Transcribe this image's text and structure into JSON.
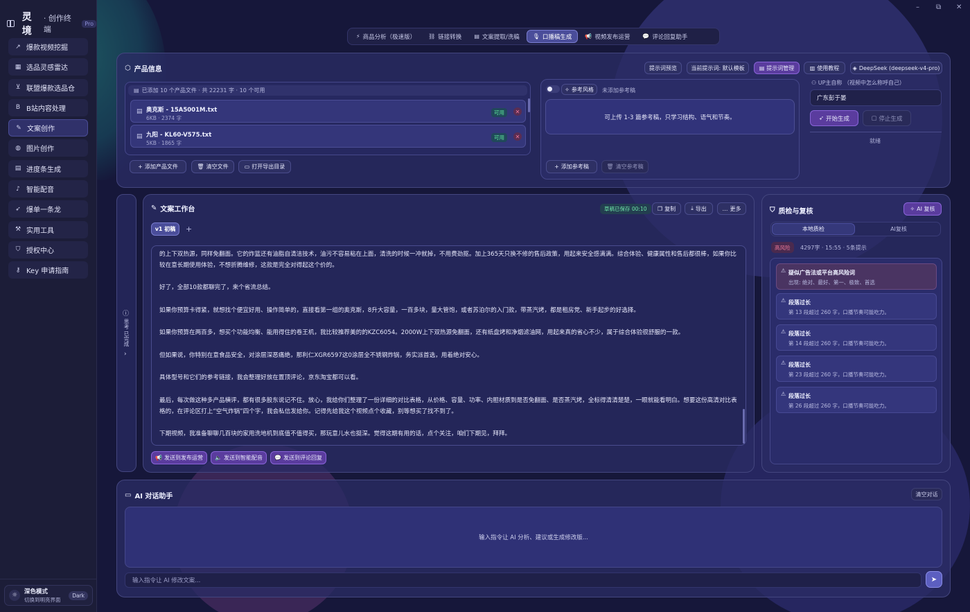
{
  "app": {
    "name": "灵境",
    "subtitle": "· 创作终端",
    "badge": "Pro"
  },
  "window": {
    "minimize": "–",
    "maximize": "⧉",
    "close": "✕"
  },
  "sidebar": {
    "items": [
      {
        "label": "爆款视频挖掘",
        "icon": "trend-icon"
      },
      {
        "label": "选品灵感雷达",
        "icon": "calendar-icon"
      },
      {
        "label": "联盟爆款选品仓",
        "icon": "cart-icon"
      },
      {
        "label": "B站内容处理",
        "icon": "bilibili-icon"
      },
      {
        "label": "文案创作",
        "icon": "pen-icon",
        "active": true
      },
      {
        "label": "图片创作",
        "icon": "palette-icon"
      },
      {
        "label": "进度条生成",
        "icon": "film-icon"
      },
      {
        "label": "智能配音",
        "icon": "mic-icon"
      },
      {
        "label": "爆单一条龙",
        "icon": "rocket-icon"
      },
      {
        "label": "实用工具",
        "icon": "wrench-icon"
      },
      {
        "label": "授权中心",
        "icon": "shield-icon"
      },
      {
        "label": "Key 申请指南",
        "icon": "key-icon"
      }
    ],
    "theme": {
      "title": "深色模式",
      "desc": "切换到明亮界面",
      "badge": "Dark"
    }
  },
  "top_tabs": [
    {
      "label": "商品分析（极速版）",
      "icon": "⚡"
    },
    {
      "label": "链接转换",
      "icon": "⛓"
    },
    {
      "label": "文案提取/洗稿",
      "icon": "▤"
    },
    {
      "label": "口播稿生成",
      "icon": "🎙",
      "active": true
    },
    {
      "label": "视频发布运营",
      "icon": "📢"
    },
    {
      "label": "评论回复助手",
      "icon": "💬"
    }
  ],
  "product": {
    "title": "产品信息",
    "buttons": {
      "preview": "提示词预览",
      "current": "当前提示词: 默认模板",
      "manage": "提示词管理",
      "tutorial": "使用教程",
      "model": "DeepSeek (deepseek-v4-pro)"
    },
    "files_summary": "已添加 10 个产品文件 · 共 22231 字 · 10 个可用",
    "files": [
      {
        "name": "奥克斯 - 15A5001M.txt",
        "meta": "6KB · 2374 字",
        "status": "可用"
      },
      {
        "name": "九阳 - KL60-V575.txt",
        "meta": "5KB · 1865 字",
        "status": "可用"
      }
    ],
    "actions": {
      "add": "添加产品文件",
      "clear": "清空文件",
      "open": "打开导出目录"
    },
    "reference": {
      "style_label": "参考风格",
      "none": "未添加参考稿",
      "hint": "可上传 1-3 篇参考稿，只学习结构、语气和节奏。",
      "add": "添加参考稿",
      "clear": "清空参考稿"
    },
    "up": {
      "label": "UP主自称 （视频中怎么称呼自己）",
      "value": "广东彭于晏"
    },
    "start": "开始生成",
    "stop": "停止生成",
    "status": "就绪"
  },
  "strip": {
    "label": "思考 已完成"
  },
  "workbench": {
    "title": "文案工作台",
    "saved": "草稿已保存 00:10",
    "copy": "复制",
    "export": "导出",
    "more": "更多",
    "version_tab": "v1 初稿",
    "add_tab": "+",
    "paragraphs": [
      "的上下双热源，同样免翻面。它的炸篮还有油脂自清洁技术，油污不容易粘在上面，清洗的时候一冲就掉，不用费劲抠。加上365天只换不修的售后政策，用起来安全感满满。综合体验、健康属性和售后都很棒，如果你比较在意长期使用体验，不想折腾维修，这款是完全对得起这个价的。",
      "好了，全部10款都聊完了，来个省流总结。",
      "如果你预算卡得紧，就想找个便宜好用、操作简单的，直接看第一组的奥克斯，8升大容量，一百多块，量大管饱，或者苏泊尔的入门款，带蒸汽烤，都是租房党、新手起步的好选择。",
      "如果你预算在两百多，想买个功能均衡、能用得住的卷王机，我比较推荐美的的KZC6054。2000W上下双热源免翻面，还有纸盘烤和净烟滤油网，用起来真的省心不少，属于综合体验很舒服的一款。",
      "但如果说，你特别在意食品安全，对涂层深恶痛绝，那利仁XGR6597这0涂层全不锈钢炸锅，务实派首选，用着绝对安心。",
      "具体型号和它们的参考链接，我会整理好放在置顶评论，京东淘宝都可以看。",
      "最后，每次做这种多产品横评，都有很多股东说记不住。放心，我给你们整理了一份详细的对比表格，从价格、容量、功率、内胆材质到是否免翻面、是否蒸汽烤，全标得清清楚楚，一眼就能看明白。想要这份高清对比表格的，在评论区打上“空气炸锅”四个字，我会私信发给你。记得先给我这个视频点个收藏，别等想买了找不到了。",
      "下期视频，我准备聊聊几百块的家用洗地机到底值不值得买，那玩意儿水也挺深。觉得这期有用的话，点个关注，咱们下期见，拜拜。"
    ],
    "send": {
      "publish": "发送到发布运营",
      "voice": "发送到智能配音",
      "comment": "发送到评论回复"
    }
  },
  "quality": {
    "title": "质检与复核",
    "ai_review": "AI 复核",
    "tabs": [
      "本地质检",
      "AI复核"
    ],
    "risk": "高风险",
    "meta": "4297字 · 15:55 · 5条提示",
    "issues": [
      {
        "title": "疑似广告法或平台高风险词",
        "desc": "出现: 绝对、最好、第一、极致、首选"
      },
      {
        "title": "段落过长",
        "desc": "第 13 段超过 260 字，口播节奏可能吃力。"
      },
      {
        "title": "段落过长",
        "desc": "第 14 段超过 260 字，口播节奏可能吃力。"
      },
      {
        "title": "段落过长",
        "desc": "第 23 段超过 260 字，口播节奏可能吃力。"
      },
      {
        "title": "段落过长",
        "desc": "第 26 段超过 260 字，口播节奏可能吃力。"
      }
    ]
  },
  "chat": {
    "title": "AI 对话助手",
    "clear": "清空对话",
    "hint": "输入指令让 AI 分析、建议或生成修改版...",
    "placeholder": "输入指令让 AI 修改文案..."
  },
  "colors": {
    "accent": "#5a3c9e",
    "active_tab": "#4a4d9a",
    "risk": "#f07a9a",
    "ok": "#5ee79a"
  }
}
